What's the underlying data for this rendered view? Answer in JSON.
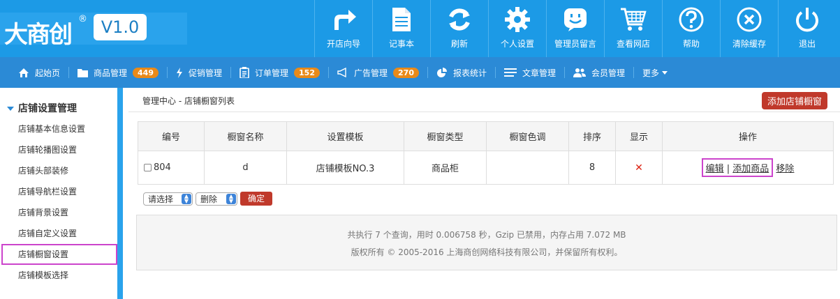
{
  "brand": {
    "name": "大商创",
    "reg": "®",
    "version": "V1.0"
  },
  "topnav": [
    {
      "label": "开店向导",
      "icon": "redo-arrow-icon"
    },
    {
      "label": "记事本",
      "icon": "notepad-icon"
    },
    {
      "label": "刷新",
      "icon": "refresh-icon"
    },
    {
      "label": "个人设置",
      "icon": "gear-icon"
    },
    {
      "label": "管理员留言",
      "icon": "chat-smile-icon"
    },
    {
      "label": "查看网店",
      "icon": "shopping-cart-icon"
    },
    {
      "label": "帮助",
      "icon": "question-icon"
    },
    {
      "label": "清除缓存",
      "icon": "close-circle-icon"
    },
    {
      "label": "退出",
      "icon": "power-icon"
    }
  ],
  "subnav": [
    {
      "label": "起始页",
      "icon": "home-icon"
    },
    {
      "label": "商品管理",
      "icon": "folder-icon",
      "badge": "449"
    },
    {
      "label": "促销管理",
      "icon": "bolt-icon"
    },
    {
      "label": "订单管理",
      "icon": "clipboard-icon",
      "badge": "152"
    },
    {
      "label": "广告管理",
      "icon": "megaphone-icon",
      "badge": "270"
    },
    {
      "label": "报表统计",
      "icon": "pie-chart-icon"
    },
    {
      "label": "文章管理",
      "icon": "list-icon"
    },
    {
      "label": "会员管理",
      "icon": "users-icon"
    },
    {
      "label": "更多",
      "icon": "caret-down-icon"
    }
  ],
  "sidebar": {
    "title": "店铺设置管理",
    "items": [
      "店铺基本信息设置",
      "店铺轮播图设置",
      "店铺头部装修",
      "店铺导航栏设置",
      "店铺背景设置",
      "店铺自定义设置",
      "店铺橱窗设置",
      "店铺模板选择"
    ],
    "active_index": 6
  },
  "breadcrumb": {
    "root": "管理中心",
    "sep": " - ",
    "current": "店铺橱窗列表"
  },
  "add_button": "添加店铺橱窗",
  "table": {
    "headers": [
      "编号",
      "橱窗名称",
      "设置模板",
      "橱窗类型",
      "橱窗色调",
      "排序",
      "显示",
      "操作"
    ],
    "rows": [
      {
        "id": "804",
        "name": "d",
        "template": "店铺模板NO.3",
        "type": "商品柜",
        "color": "",
        "sort": "8",
        "show": "✕",
        "op_edit": "编辑",
        "op_sep": " | ",
        "op_add": "添加商品",
        "op_remove": "移除"
      }
    ]
  },
  "controls": {
    "select1": "请选择",
    "select2": "删除",
    "confirm": "确定"
  },
  "footer": {
    "line1": "共执行 7 个查询，用时 0.006758 秒，Gzip 已禁用，内存占用 7.072 MB",
    "line2": "版权所有 © 2005-2016 上海商创网络科技有限公司，并保留所有权利。"
  },
  "colors": {
    "header": "#1c9ae6",
    "subnav": "#2b8ad6",
    "badge": "#e98a19",
    "danger": "#c0392b",
    "highlight": "#cc44cc"
  }
}
